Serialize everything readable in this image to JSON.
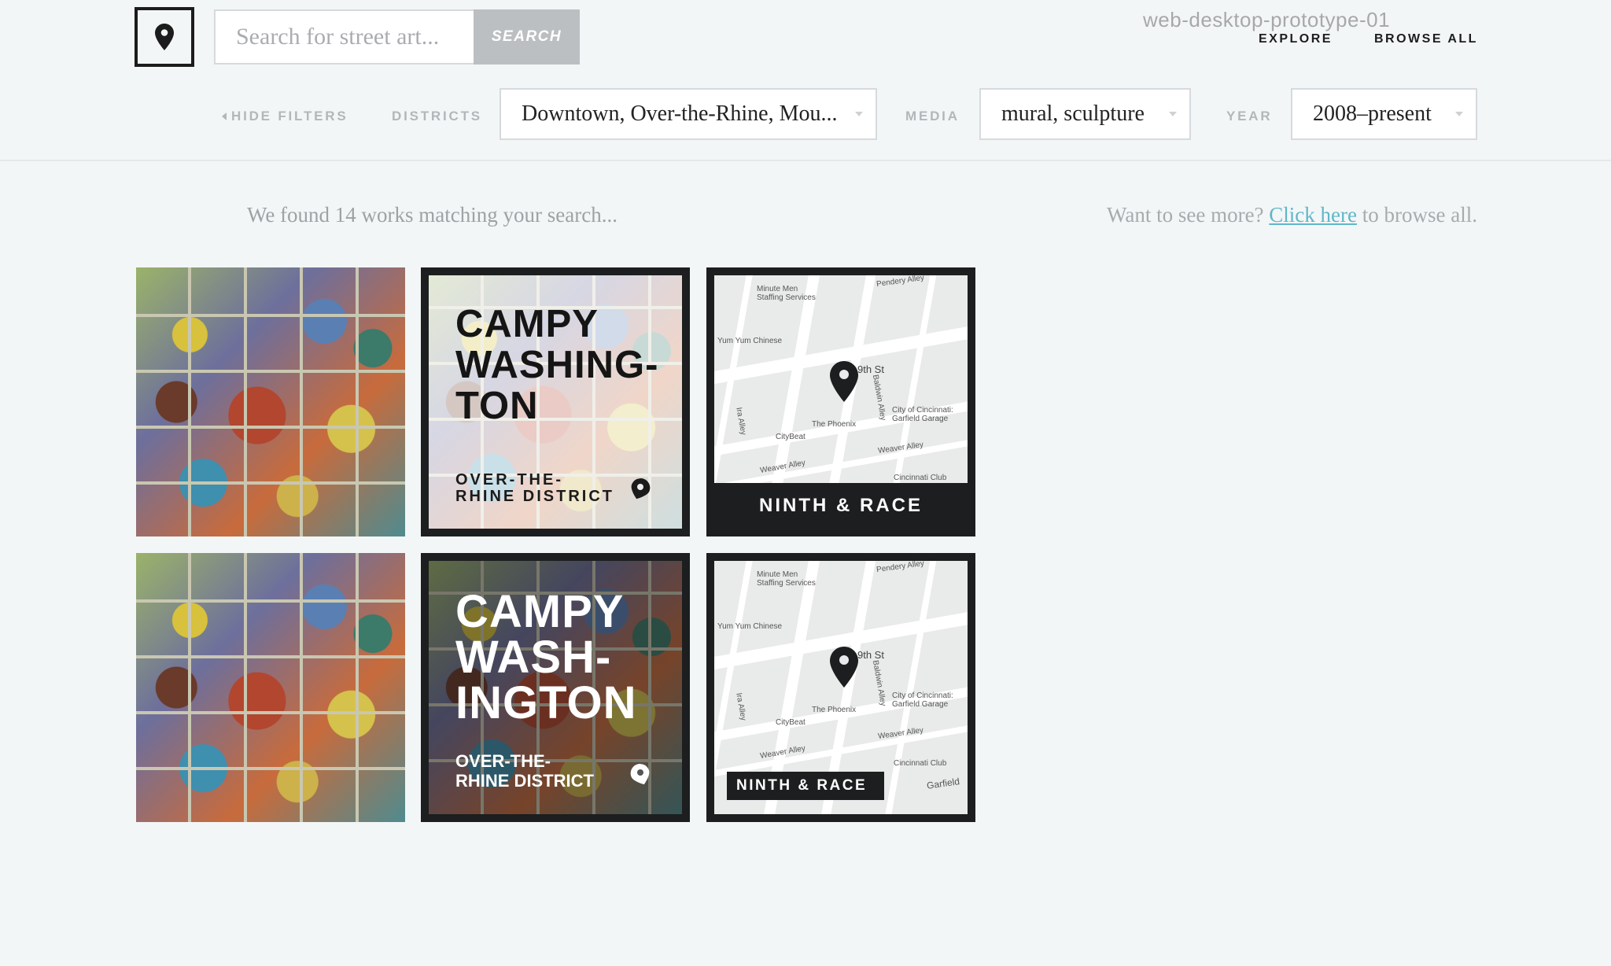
{
  "header": {
    "search_placeholder": "Search for street art...",
    "search_button": "SEARCH",
    "prototype_label": "web-desktop-prototype-01",
    "nav": {
      "explore": "EXPLORE",
      "browse_all": "BROWSE ALL"
    }
  },
  "filters": {
    "hide_label": "HIDE FILTERS",
    "districts_label": "DISTRICTS",
    "districts_value": "Downtown, Over-the-Rhine, Mou...",
    "media_label": "MEDIA",
    "media_value": "mural, sculpture",
    "year_label": "YEAR",
    "year_value": "2008–present"
  },
  "results": {
    "found_text": "We found 14 works matching your search...",
    "more_prefix": "Want to see more?",
    "more_link": "Click here",
    "more_suffix": "to browse all."
  },
  "tiles": {
    "card1_title": "CAMPY\nWASHING-\nTON",
    "card1_subtitle": "OVER-THE-\nRHINE DISTRICT",
    "card2_title": "CAMPY\nWASH-\nINGTON",
    "card2_subtitle": "OVER-THE-\nRHINE DISTRICT",
    "map1_label": "NINTH & RACE",
    "map2_label": "NINTH & RACE"
  },
  "map_labels": {
    "minute_men": "Minute Men\nStaffing Services",
    "yum_yum": "Yum Yum Chinese",
    "ninth": "9th St",
    "phoenix": "The Phoenix",
    "citybeat": "CityBeat",
    "garage": "City of Cincinnati:\nGarfield Garage",
    "weaver1": "Weaver Alley",
    "weaver2": "Weaver Alley",
    "cincy_club": "Cincinnati Club",
    "baldwin": "Baldwin Alley",
    "ira": "Ira Alley",
    "pendery": "Pendery Alley",
    "garfield": "Garfield"
  }
}
